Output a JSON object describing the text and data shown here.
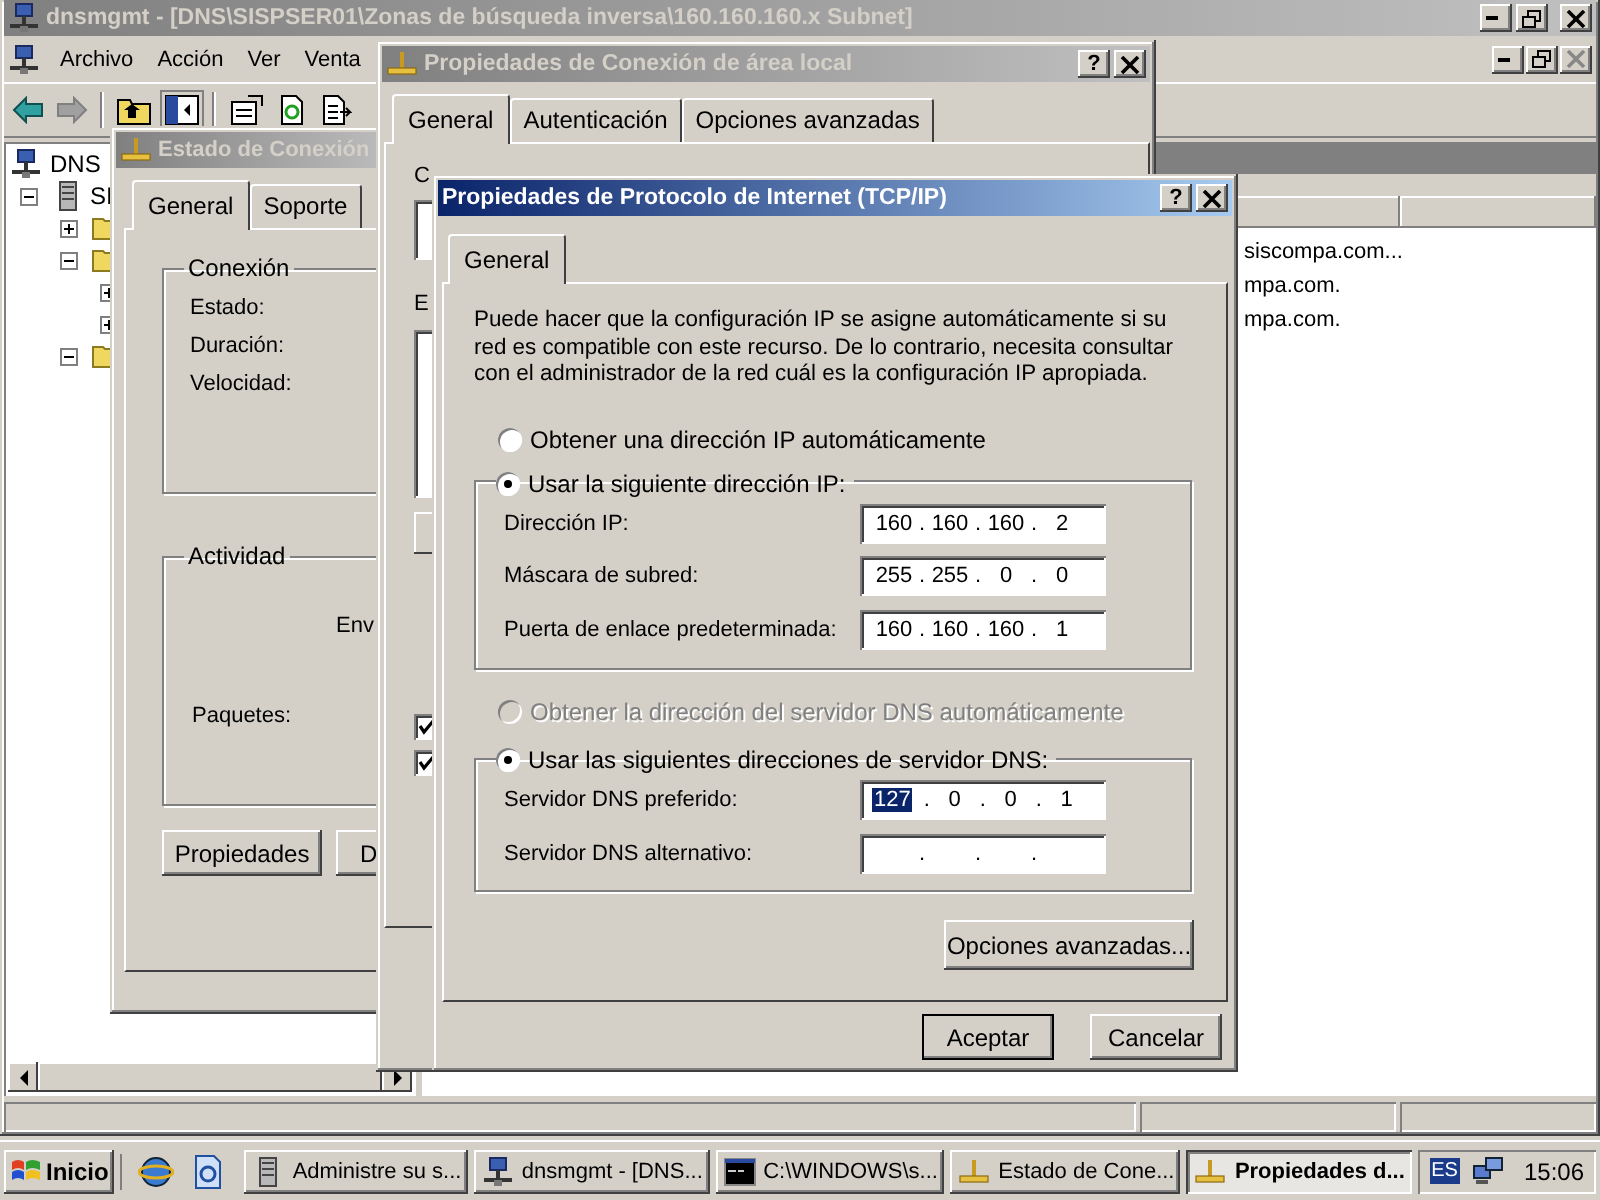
{
  "main_window": {
    "title": "dnsmgmt - [DNS\\SISPSER01\\Zonas de búsqueda inversa\\160.160.160.x Subnet]",
    "active": false,
    "menu": [
      "Archivo",
      "Acción",
      "Ver",
      "Venta"
    ],
    "tree": [
      {
        "label": "DNS",
        "kind": "network",
        "children": [
          {
            "label": "SI",
            "kind": "server",
            "expanded": true,
            "children": [
              {
                "kind": "folder",
                "expanded": false
              },
              {
                "kind": "folder",
                "expanded": true,
                "children": [
                  {
                    "expanded": false
                  },
                  {
                    "expanded": false
                  }
                ]
              },
              {
                "kind": "folder",
                "expanded": true
              }
            ]
          }
        ]
      }
    ],
    "list_rows": [
      "siscompa.com...",
      "mpa.com.",
      "mpa.com."
    ]
  },
  "connection_status_window": {
    "title": "Estado de Conexión",
    "active": false,
    "tabs": [
      {
        "label": "General",
        "selected": true
      },
      {
        "label": "Soporte",
        "selected": false
      }
    ],
    "connection_group": {
      "title": "Conexión",
      "labels": [
        "Estado:",
        "Duración:",
        "Velocidad:"
      ]
    },
    "activity_group": {
      "title": "Actividad",
      "sent_heading": "Env",
      "packets_label": "Paquetes:"
    },
    "buttons": [
      "Propiedades",
      "D"
    ]
  },
  "lan_properties_window": {
    "title": "Propiedades de Conexión de área local",
    "active": false,
    "help_button": "?",
    "tabs": [
      {
        "label": "General",
        "selected": true
      },
      {
        "label": "Autenticación",
        "selected": false
      },
      {
        "label": "Opciones avanzadas",
        "selected": false
      }
    ],
    "partial_labels": [
      "C",
      "E"
    ],
    "checkboxes": [
      {
        "checked": true
      },
      {
        "checked": true
      }
    ]
  },
  "tcpip_dialog": {
    "title": "Propiedades de Protocolo de Internet (TCP/IP)",
    "active": true,
    "help_button": "?",
    "tabs": [
      {
        "label": "General",
        "selected": true
      }
    ],
    "description": "Puede hacer que la configuración IP se asigne automáticamente si su red es compatible con este recurso. De lo contrario, necesita consultar con el administrador de la red cuál es la configuración IP apropiada.",
    "ip_auto": {
      "label": "Obtener una dirección IP automáticamente",
      "selected": false,
      "disabled": false
    },
    "ip_manual": {
      "label": "Usar la siguiente dirección IP:",
      "selected": true,
      "disabled": false,
      "fields": [
        {
          "label": "Dirección IP:",
          "separator": ".",
          "octets": [
            {
              "text": "160",
              "selected": false
            },
            {
              "text": "160",
              "selected": false
            },
            {
              "text": "160",
              "selected": false
            },
            {
              "text": "2",
              "selected": false
            }
          ]
        },
        {
          "label": "Máscara de subred:",
          "separator": ".",
          "octets": [
            {
              "text": "255",
              "selected": false
            },
            {
              "text": "255",
              "selected": false
            },
            {
              "text": "0",
              "selected": false
            },
            {
              "text": "0",
              "selected": false
            }
          ]
        },
        {
          "label": "Puerta de enlace predeterminada:",
          "separator": ".",
          "octets": [
            {
              "text": "160",
              "selected": false
            },
            {
              "text": "160",
              "selected": false
            },
            {
              "text": "160",
              "selected": false
            },
            {
              "text": "1",
              "selected": false
            }
          ]
        }
      ]
    },
    "dns_auto": {
      "label": "Obtener la dirección del servidor DNS automáticamente",
      "selected": false,
      "disabled": true
    },
    "dns_manual": {
      "label": "Usar las siguientes direcciones de servidor DNS:",
      "selected": true,
      "disabled": false,
      "fields": [
        {
          "label": "Servidor DNS preferido:",
          "separator": ".",
          "octets": [
            {
              "text": "127",
              "selected": true
            },
            {
              "text": "0",
              "selected": false
            },
            {
              "text": "0",
              "selected": false
            },
            {
              "text": "1",
              "selected": false
            }
          ]
        },
        {
          "label": "Servidor DNS alternativo:",
          "separator": "."
        }
      ]
    },
    "advanced_button": "Opciones avanzadas...",
    "buttons": [
      {
        "label": "Aceptar",
        "default": true
      },
      {
        "label": "Cancelar",
        "default": false
      }
    ]
  },
  "taskbar": {
    "start": "Inicio",
    "tasks": [
      {
        "label": "Administre su s...",
        "kind": "server",
        "selected": false
      },
      {
        "label": "dnsmgmt - [DNS...",
        "kind": "network",
        "selected": false
      },
      {
        "label": "C:\\WINDOWS\\s...",
        "kind": "console",
        "selected": false
      },
      {
        "label": "Estado de Cone...",
        "kind": "connection",
        "selected": false
      },
      {
        "label": "Propiedades d...",
        "kind": "connection",
        "selected": true
      }
    ],
    "language": "ES",
    "clock": "15:06"
  }
}
